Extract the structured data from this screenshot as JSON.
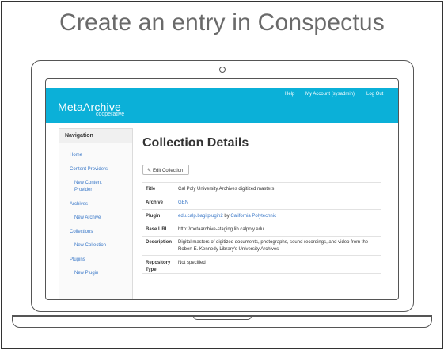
{
  "slide": {
    "title": "Create an entry in Conspectus"
  },
  "app": {
    "logo_text": "MetaArchive",
    "logo_subtext": "cooperative",
    "topnav": {
      "help": "Help",
      "account": "My Account (sysadmin)",
      "logout": "Log Out"
    },
    "brand_color": "#0bb0d8"
  },
  "sidebar": {
    "heading": "Navigation",
    "items": [
      {
        "label": "Home"
      },
      {
        "label": "Content Providers"
      },
      {
        "label": "New Content Provider"
      },
      {
        "label": "Archives"
      },
      {
        "label": "New Archive"
      },
      {
        "label": "Collections"
      },
      {
        "label": "New Collection"
      },
      {
        "label": "Plugins"
      },
      {
        "label": "New Plugin"
      }
    ]
  },
  "main": {
    "heading": "Collection Details",
    "edit_button": "Edit Collection",
    "details": {
      "title": {
        "label": "Title",
        "value": "Cal Poly University Archives digitized masters"
      },
      "archive": {
        "label": "Archive",
        "value": "GEN"
      },
      "plugin": {
        "label": "Plugin",
        "value": "edu.calp.bagitplugin2",
        "by": "by",
        "org": "California Polytechnic"
      },
      "base_url": {
        "label": "Base URL",
        "value": "http://metaarchive-staging.lib.calpoly.edu"
      },
      "description": {
        "label": "Description",
        "value": "Digital masters of digitized documents, photographs, sound recordings, and video from the Robert E. Kennedy Library's University Archives"
      },
      "repository_type": {
        "label": "Repository Type",
        "value": "Not specified"
      }
    }
  }
}
